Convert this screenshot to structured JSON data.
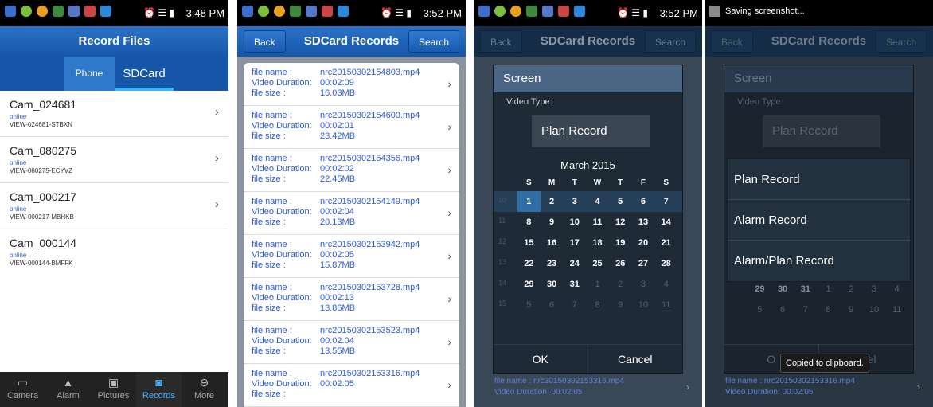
{
  "panel1": {
    "time": "3:48 PM",
    "title": "Record Files",
    "tabs": [
      "Phone",
      "SDCard"
    ],
    "cameras": [
      {
        "name": "Cam_024681",
        "status": "online",
        "id": "VIEW-024681-STBXN"
      },
      {
        "name": "Cam_080275",
        "status": "online",
        "id": "VIEW-080275-ECYVZ"
      },
      {
        "name": "Cam_000217",
        "status": "online",
        "id": "VIEW-000217-MBHKB"
      },
      {
        "name": "Cam_000144",
        "status": "online",
        "id": "VIEW-000144-BMFFK"
      }
    ],
    "nav": [
      {
        "label": "Camera",
        "icon": "camera-icon"
      },
      {
        "label": "Alarm",
        "icon": "alarm-icon"
      },
      {
        "label": "Pictures",
        "icon": "pictures-icon"
      },
      {
        "label": "Records",
        "icon": "records-icon"
      },
      {
        "label": "More",
        "icon": "more-icon"
      }
    ]
  },
  "panel2": {
    "time": "3:52 PM",
    "title": "SDCard Records",
    "back": "Back",
    "search": "Search",
    "labels": {
      "file": "file name :",
      "dur": "Video Duration:",
      "size": "file size :"
    },
    "records": [
      {
        "file": "nrc20150302154803.mp4",
        "dur": "00:02:09",
        "size": "16.03MB"
      },
      {
        "file": "nrc20150302154600.mp4",
        "dur": "00:02:01",
        "size": "23.42MB"
      },
      {
        "file": "nrc20150302154356.mp4",
        "dur": "00:02:02",
        "size": "22.45MB"
      },
      {
        "file": "nrc20150302154149.mp4",
        "dur": "00:02:04",
        "size": "20.13MB"
      },
      {
        "file": "nrc20150302153942.mp4",
        "dur": "00:02:05",
        "size": "15.87MB"
      },
      {
        "file": "nrc20150302153728.mp4",
        "dur": "00:02:13",
        "size": "13.86MB"
      },
      {
        "file": "nrc20150302153523.mp4",
        "dur": "00:02:04",
        "size": "13.55MB"
      },
      {
        "file": "nrc20150302153316.mp4",
        "dur": "00:02:05",
        "size": ""
      }
    ]
  },
  "panel3": {
    "time": "3:52 PM",
    "title": "SDCard Records",
    "back": "Back",
    "search": "Search",
    "dialog_title": "Screen",
    "video_type_label": "Video Type:",
    "video_type_value": "Plan Record",
    "month": "March 2015",
    "dow": [
      "S",
      "M",
      "T",
      "W",
      "T",
      "F",
      "S"
    ],
    "weeks": [
      {
        "wn": "10",
        "days": [
          "1",
          "2",
          "3",
          "4",
          "5",
          "6",
          "7"
        ]
      },
      {
        "wn": "11",
        "days": [
          "8",
          "9",
          "10",
          "11",
          "12",
          "13",
          "14"
        ]
      },
      {
        "wn": "12",
        "days": [
          "15",
          "16",
          "17",
          "18",
          "19",
          "20",
          "21"
        ]
      },
      {
        "wn": "13",
        "days": [
          "22",
          "23",
          "24",
          "25",
          "26",
          "27",
          "28"
        ]
      },
      {
        "wn": "14",
        "days": [
          "29",
          "30",
          "31",
          "1",
          "2",
          "3",
          "4"
        ]
      },
      {
        "wn": "15",
        "days": [
          "5",
          "6",
          "7",
          "8",
          "9",
          "10",
          "11"
        ]
      }
    ],
    "ok": "OK",
    "cancel": "Cancel",
    "under_file": "file name :      nrc20150302153316.mp4",
    "under_dur": "Video Duration:  00:02:05"
  },
  "panel4": {
    "status_text": "Saving screenshot...",
    "title": "SDCard Records",
    "back": "Back",
    "search": "Search",
    "dialog_title": "Screen",
    "video_type_label": "Video Type:",
    "video_type_value": "Plan Record",
    "options": [
      "Plan Record",
      "Alarm Record",
      "Alarm/Plan Record"
    ],
    "partial_week": [
      "29",
      "30",
      "31",
      "1",
      "2",
      "3",
      "4"
    ],
    "partial_week2": [
      "5",
      "6",
      "7",
      "8",
      "9",
      "10",
      "11"
    ],
    "toast": "Copied to clipboard.",
    "ok": "O",
    "cancel": "ncel",
    "under_file": "file name :      nrc20150302153316.mp4",
    "under_dur": "Video Duration:  00:02:05"
  }
}
